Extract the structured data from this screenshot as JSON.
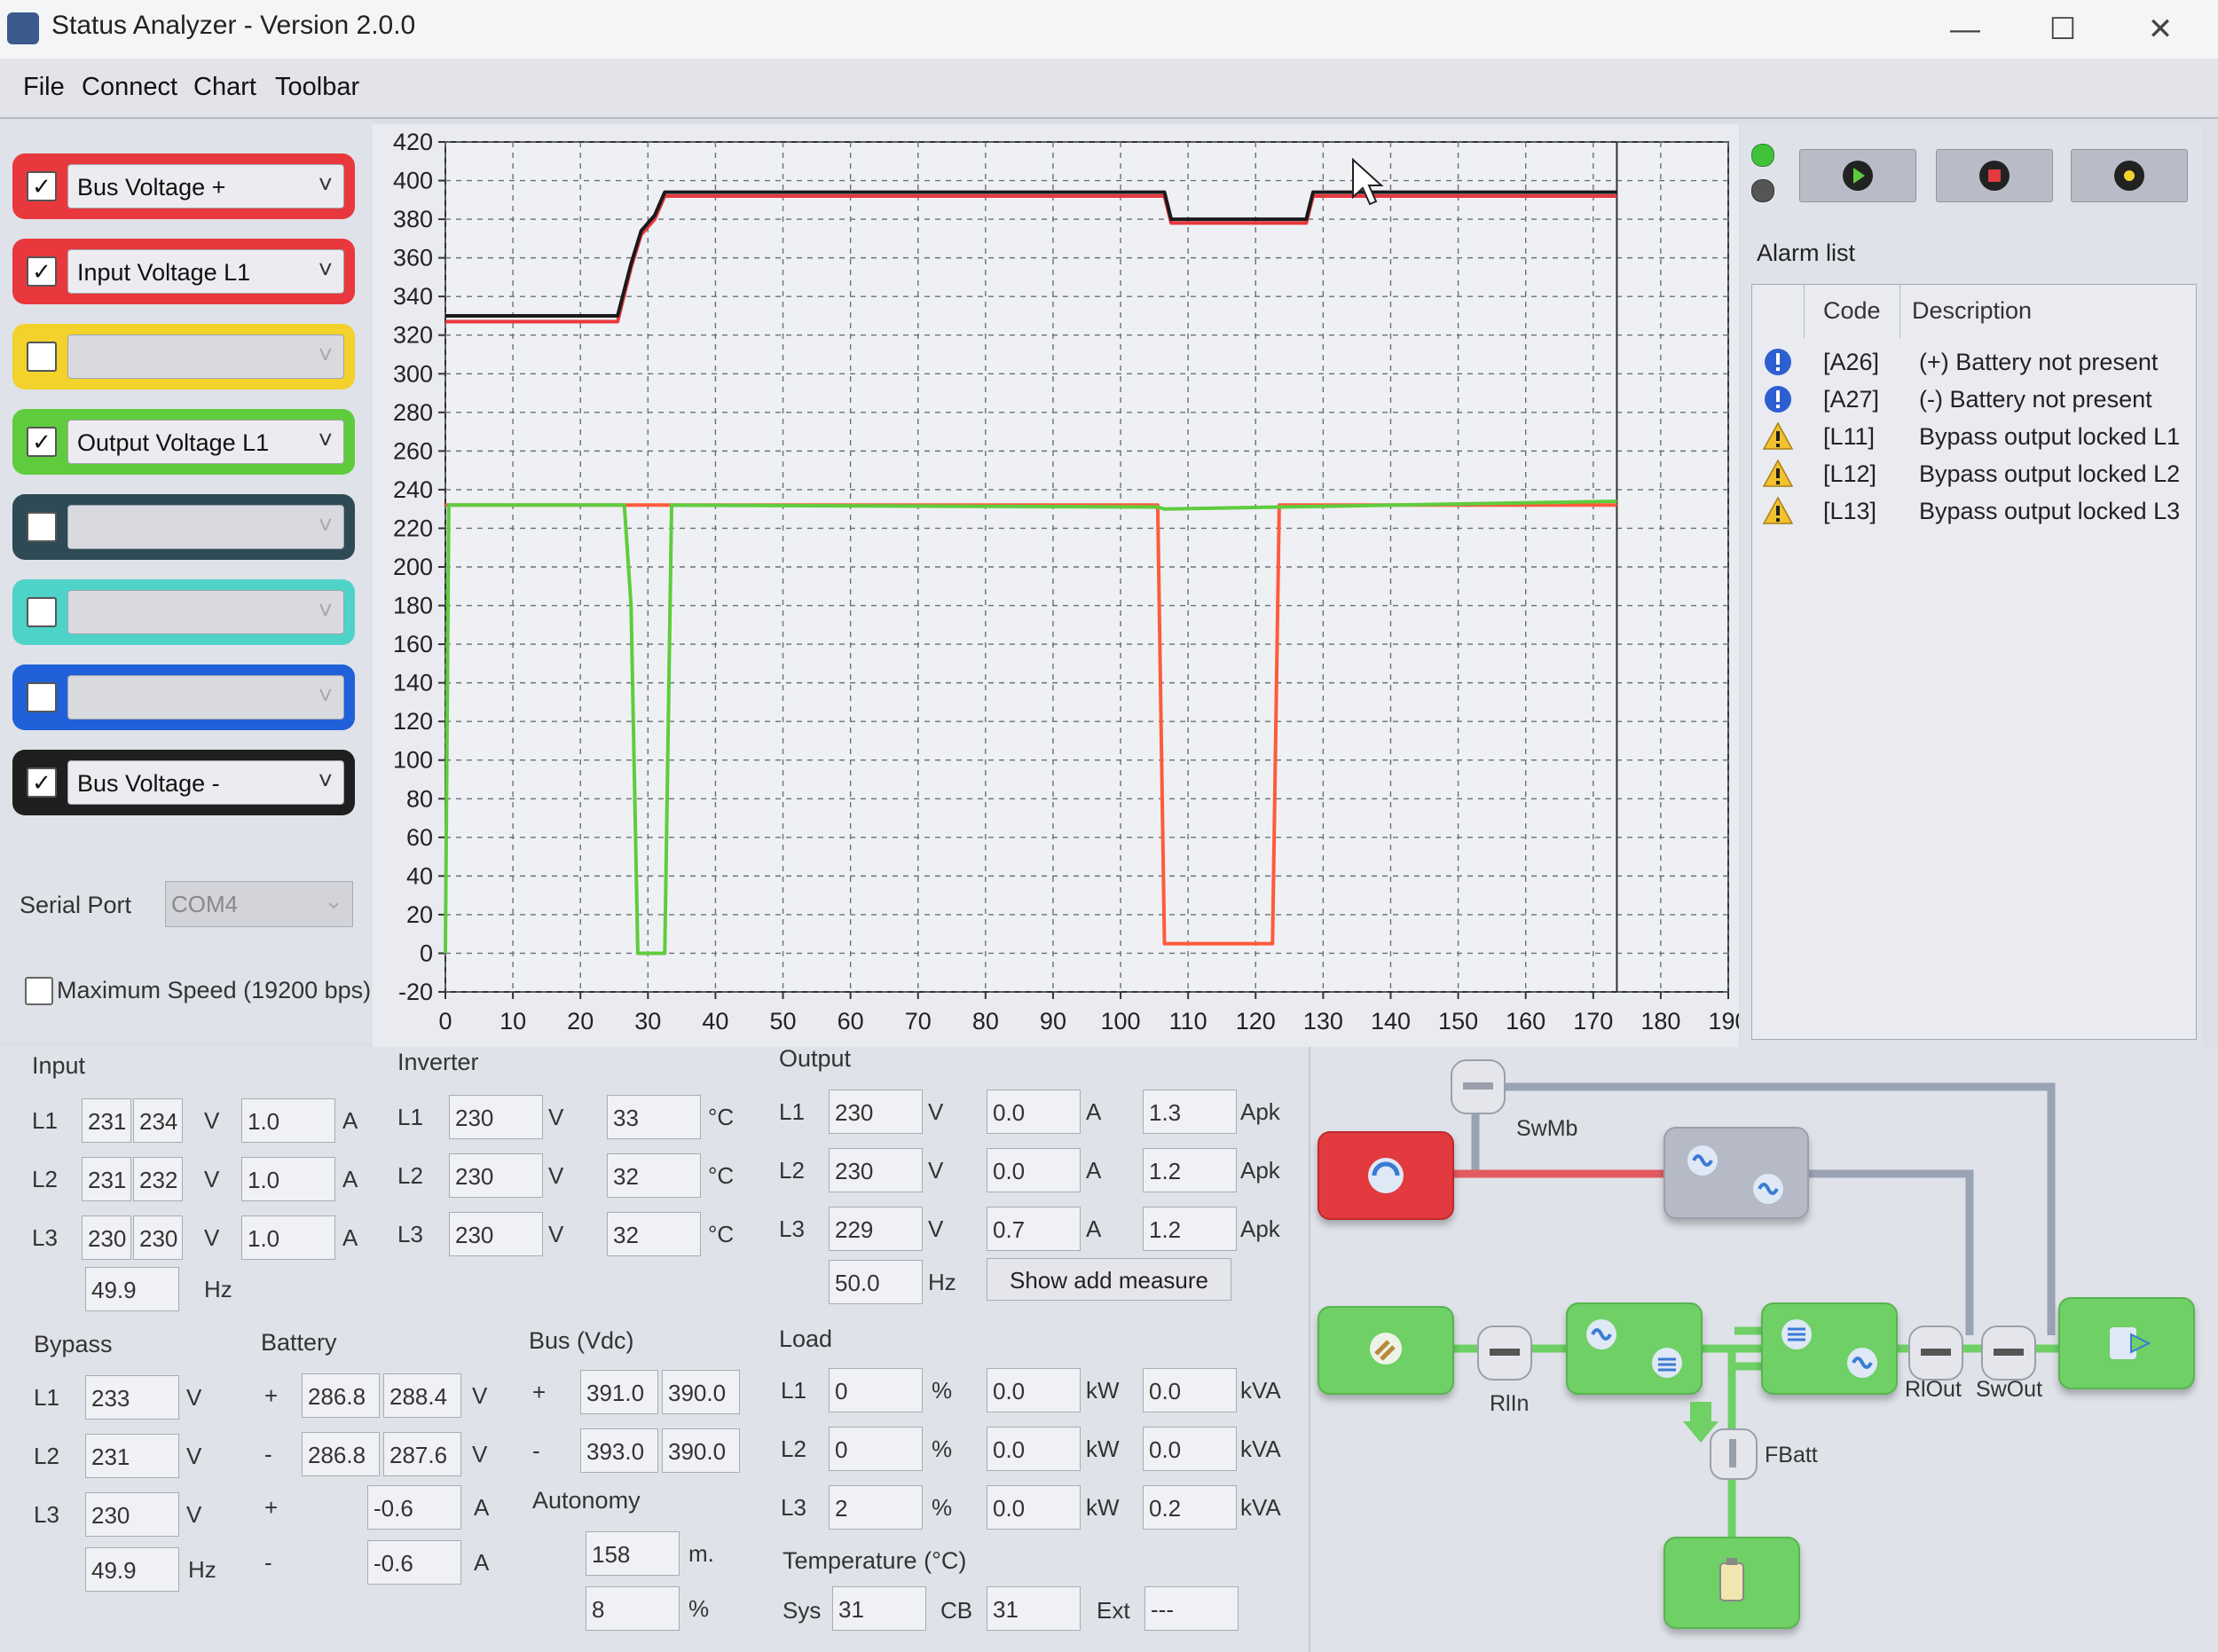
{
  "window": {
    "title": "Status Analyzer - Version 2.0.0"
  },
  "menu": [
    "File",
    "Connect",
    "Chart",
    "Toolbar"
  ],
  "series_selectors": [
    {
      "checked": true,
      "label": "Bus Voltage +",
      "color": "#e8383d"
    },
    {
      "checked": true,
      "label": "Input Voltage L1",
      "color": "#e8383d"
    },
    {
      "checked": false,
      "label": "",
      "color": "#f2d22b"
    },
    {
      "checked": true,
      "label": "Output Voltage L1",
      "color": "#5fcc3d"
    },
    {
      "checked": false,
      "label": "",
      "color": "#2e4a55"
    },
    {
      "checked": false,
      "label": "",
      "color": "#4ed3c9"
    },
    {
      "checked": false,
      "label": "",
      "color": "#2060d8"
    },
    {
      "checked": true,
      "label": "Bus Voltage -",
      "color": "#1f1f1f"
    }
  ],
  "serial": {
    "label": "Serial Port",
    "value": "COM4",
    "max_speed_label": "Maximum Speed (19200 bps)",
    "max_speed_checked": false
  },
  "chart_data": {
    "type": "line",
    "xlim": [
      0,
      190
    ],
    "ylim": [
      -20,
      420
    ],
    "x_ticks": [
      0,
      10,
      20,
      30,
      40,
      50,
      60,
      70,
      80,
      90,
      100,
      110,
      120,
      130,
      140,
      150,
      160,
      170,
      180,
      190
    ],
    "y_ticks": [
      -20,
      0,
      20,
      40,
      60,
      80,
      100,
      120,
      140,
      160,
      180,
      200,
      220,
      240,
      260,
      280,
      300,
      320,
      340,
      360,
      380,
      400,
      420
    ],
    "grid": true,
    "series": [
      {
        "color": "#e8383d",
        "points": [
          [
            0,
            327
          ],
          [
            25.5,
            327
          ],
          [
            27.5,
            355
          ],
          [
            29,
            372
          ],
          [
            31,
            380
          ],
          [
            32.5,
            392
          ],
          [
            106.5,
            392
          ],
          [
            107.5,
            378
          ],
          [
            127.5,
            378
          ],
          [
            128.5,
            392
          ],
          [
            173.5,
            392
          ]
        ]
      },
      {
        "color": "#1a1a1a",
        "points": [
          [
            0,
            330
          ],
          [
            25.5,
            330
          ],
          [
            27.5,
            357
          ],
          [
            29,
            374
          ],
          [
            31,
            382
          ],
          [
            32.5,
            394
          ],
          [
            106.5,
            394
          ],
          [
            107.5,
            380
          ],
          [
            127.5,
            380
          ],
          [
            128.5,
            394
          ],
          [
            173.5,
            394
          ]
        ]
      },
      {
        "color": "#ff5a3c",
        "points": [
          [
            0,
            232
          ],
          [
            105.5,
            232
          ],
          [
            106.5,
            5
          ],
          [
            122.5,
            5
          ],
          [
            123.5,
            232
          ],
          [
            173.5,
            232
          ]
        ]
      },
      {
        "color": "#5fcc3d",
        "points": [
          [
            0,
            0
          ],
          [
            0.5,
            232
          ],
          [
            26.5,
            232
          ],
          [
            27.5,
            180
          ],
          [
            28.5,
            0
          ],
          [
            32.5,
            0
          ],
          [
            33.5,
            232
          ],
          [
            105.5,
            231
          ],
          [
            106.5,
            230
          ],
          [
            173.5,
            234
          ]
        ]
      }
    ]
  },
  "toolbar_buttons": [
    "play-icon",
    "stop-icon",
    "record-icon"
  ],
  "alarm_list": {
    "title": "Alarm list",
    "headers": [
      "Code",
      "Description"
    ],
    "items": [
      {
        "type": "info",
        "code": "[A26]",
        "description": "(+) Battery not present"
      },
      {
        "type": "info",
        "code": "[A27]",
        "description": "(-) Battery not present"
      },
      {
        "type": "warning",
        "code": "[L11]",
        "description": "Bypass output locked L1"
      },
      {
        "type": "warning",
        "code": "[L12]",
        "description": "Bypass output locked L2"
      },
      {
        "type": "warning",
        "code": "[L13]",
        "description": "Bypass output locked L3"
      }
    ]
  },
  "input": {
    "title": "Input",
    "rows": [
      {
        "label": "L1",
        "v1": "231",
        "v2": "234",
        "a": "1.0"
      },
      {
        "label": "L2",
        "v1": "231",
        "v2": "232",
        "a": "1.0"
      },
      {
        "label": "L3",
        "v1": "230",
        "v2": "230",
        "a": "1.0"
      }
    ],
    "freq": "49.9",
    "unit_v": "V",
    "unit_a": "A",
    "unit_hz": "Hz"
  },
  "inverter": {
    "title": "Inverter",
    "rows": [
      {
        "label": "L1",
        "v": "230",
        "t": "33"
      },
      {
        "label": "L2",
        "v": "230",
        "t": "32"
      },
      {
        "label": "L3",
        "v": "230",
        "t": "32"
      }
    ],
    "unit_v": "V",
    "unit_t": "°C"
  },
  "output": {
    "title": "Output",
    "rows": [
      {
        "label": "L1",
        "v": "230",
        "a": "0.0",
        "apk": "1.3"
      },
      {
        "label": "L2",
        "v": "230",
        "a": "0.0",
        "apk": "1.2"
      },
      {
        "label": "L3",
        "v": "229",
        "a": "0.7",
        "apk": "1.2"
      }
    ],
    "freq": "50.0",
    "unit_v": "V",
    "unit_a": "A",
    "unit_apk": "Apk",
    "unit_hz": "Hz",
    "show_add_measure": "Show add measure"
  },
  "bypass": {
    "title": "Bypass",
    "rows": [
      {
        "label": "L1",
        "v": "233"
      },
      {
        "label": "L2",
        "v": "231"
      },
      {
        "label": "L3",
        "v": "230"
      }
    ],
    "freq": "49.9",
    "unit_v": "V",
    "unit_hz": "Hz"
  },
  "battery": {
    "title": "Battery",
    "rows": [
      {
        "sign": "+",
        "v1": "286.8",
        "v2": "288.4",
        "unit": "V"
      },
      {
        "sign": "-",
        "v1": "286.8",
        "v2": "287.6",
        "unit": "V"
      },
      {
        "sign": "+",
        "v1": "",
        "v2": "-0.6",
        "unit": "A"
      },
      {
        "sign": "-",
        "v1": "",
        "v2": "-0.6",
        "unit": "A"
      }
    ]
  },
  "bus": {
    "title": "Bus (Vdc)",
    "rows": [
      {
        "sign": "+",
        "v1": "391.0",
        "v2": "390.0"
      },
      {
        "sign": "-",
        "v1": "393.0",
        "v2": "390.0"
      }
    ],
    "autonomy_label": "Autonomy",
    "autonomy_min": "158",
    "autonomy_min_unit": "m.",
    "autonomy_pct": "8",
    "autonomy_pct_unit": "%"
  },
  "load": {
    "title": "Load",
    "rows": [
      {
        "label": "L1",
        "pct": "0",
        "kw": "0.0",
        "kva": "0.0"
      },
      {
        "label": "L2",
        "pct": "0",
        "kw": "0.0",
        "kva": "0.0"
      },
      {
        "label": "L3",
        "pct": "2",
        "kw": "0.0",
        "kva": "0.2"
      }
    ],
    "unit_pct": "%",
    "unit_kw": "kW",
    "unit_kva": "kVA"
  },
  "temperature": {
    "title": "Temperature (°C)",
    "sys_label": "Sys",
    "sys": "31",
    "cb_label": "CB",
    "cb": "31",
    "ext_label": "Ext",
    "ext": "---"
  },
  "diagram": {
    "labels": {
      "swmb": "SwMb",
      "rlin": "RlIn",
      "rlout": "RlOut",
      "swout": "SwOut",
      "fbatt": "FBatt"
    },
    "colors": {
      "alarm_block": "#e23a3f",
      "ok_block": "#6ed065",
      "idle_block": "#b5bac6",
      "bypass_line": "#e25a60",
      "active_line": "#6ed065",
      "idle_line": "#9aa3b5"
    }
  }
}
